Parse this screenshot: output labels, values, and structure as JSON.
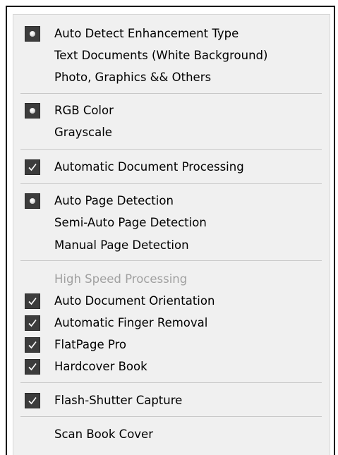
{
  "menu": {
    "items": [
      {
        "label": "Auto Detect Enhancement Type",
        "mark": "radio-selected",
        "enabled": true
      },
      {
        "label": "Text Documents (White Background)",
        "mark": "none",
        "enabled": true
      },
      {
        "label": "Photo, Graphics && Others",
        "mark": "none",
        "enabled": true
      },
      {
        "label": "RGB Color",
        "mark": "radio-selected",
        "enabled": true
      },
      {
        "label": "Grayscale",
        "mark": "none",
        "enabled": true
      },
      {
        "label": "Automatic Document Processing",
        "mark": "checked",
        "enabled": true
      },
      {
        "label": "Auto Page Detection",
        "mark": "radio-selected",
        "enabled": true
      },
      {
        "label": "Semi-Auto Page Detection",
        "mark": "none",
        "enabled": true
      },
      {
        "label": "Manual Page Detection",
        "mark": "none",
        "enabled": true
      },
      {
        "label": "High Speed Processing",
        "mark": "none",
        "enabled": false
      },
      {
        "label": "Auto Document Orientation",
        "mark": "checked",
        "enabled": true
      },
      {
        "label": "Automatic Finger Removal",
        "mark": "checked",
        "enabled": true
      },
      {
        "label": "FlatPage Pro",
        "mark": "checked",
        "enabled": true
      },
      {
        "label": "Hardcover Book",
        "mark": "checked",
        "enabled": true
      },
      {
        "label": "Flash-Shutter Capture",
        "mark": "checked",
        "enabled": true
      },
      {
        "label": "Scan Book Cover",
        "mark": "none",
        "enabled": true
      }
    ]
  },
  "colors": {
    "menu_background": "#f0f0f0",
    "mark_background": "#3c3c3c",
    "disabled_text": "#a0a0a0",
    "separator": "#c8c8c8"
  }
}
